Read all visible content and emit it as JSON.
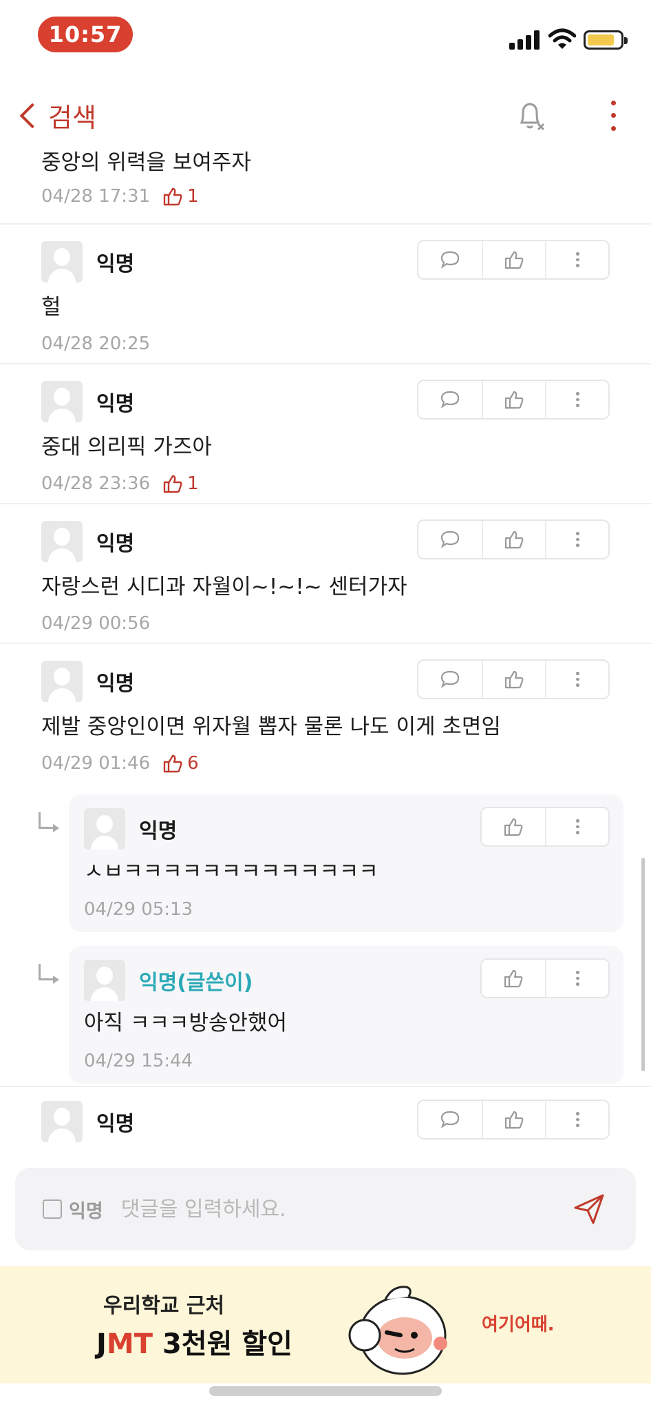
{
  "status": {
    "time": "10:57"
  },
  "nav": {
    "back_label": "검색"
  },
  "top_comment": {
    "text": "중앙의 위력을 보여주자",
    "time": "04/28 17:31",
    "likes": "1"
  },
  "comments": [
    {
      "name": "익명",
      "text": "헐",
      "time": "04/28 20:25",
      "likes": ""
    },
    {
      "name": "익명",
      "text": "중대 의리픽 가즈아",
      "time": "04/28 23:36",
      "likes": "1"
    },
    {
      "name": "익명",
      "text": "자랑스런 시디과 자월이~!~!~ 센터가자",
      "time": "04/29 00:56",
      "likes": ""
    },
    {
      "name": "익명",
      "text": "제발 중앙인이면 위자월 뽑자 물론 나도 이게 초면임",
      "time": "04/29 01:46",
      "likes": "6"
    }
  ],
  "replies": [
    {
      "name": "익명",
      "text": "ㅅㅂㅋㅋㅋㅋㅋㅋㅋㅋㅋㅋㅋㅋㅋ",
      "time": "04/29 05:13"
    },
    {
      "name": "익명(글쓴이)",
      "text": "아직 ㅋㅋㅋ방송안했어",
      "time": "04/29 15:44"
    }
  ],
  "last_comment": {
    "name": "익명"
  },
  "composer": {
    "anon_label": "익명",
    "placeholder": "댓글을 입력하세요."
  },
  "ad": {
    "line1": "우리학교 근처",
    "brand_j": "J",
    "brand_m": "M",
    "brand_t": "T",
    "discount": "3천원 할인",
    "cta": "여기어때."
  },
  "colors": {
    "accent": "#c0392b",
    "author": "#2aa9b6",
    "time_pill": "#d9402f"
  }
}
